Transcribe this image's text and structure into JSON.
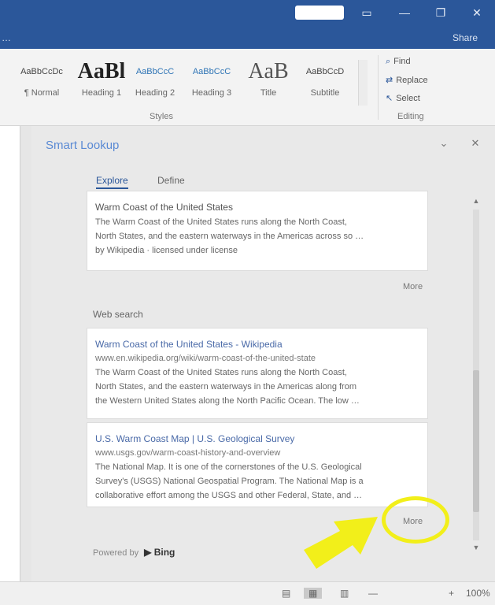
{
  "titlebar": {
    "controls": [
      "▭",
      "—",
      "❐",
      "✕"
    ]
  },
  "tellbar": {
    "left_text": "…",
    "right_text": "Share"
  },
  "ribbon": {
    "styles": [
      {
        "sample": "AaBbCcDc",
        "name": "¶ Normal"
      },
      {
        "sample": "AaBl",
        "name": "Heading 1"
      },
      {
        "sample": "AaBbCcC",
        "name": "Heading 2"
      },
      {
        "sample": "AaBbCcC",
        "name": "Heading 3"
      },
      {
        "sample": "AaB",
        "name": "Title"
      },
      {
        "sample": "AaBbCcD",
        "name": "Subtitle"
      }
    ],
    "group_styles": "Styles",
    "group_editing": "Editing",
    "editing": [
      "Find",
      "Replace",
      "Select"
    ]
  },
  "smart_lookup": {
    "title": "Smart Lookup",
    "tabs": [
      "Explore",
      "Define"
    ],
    "definition_card": {
      "title": "Warm Coast of the United States",
      "lines": [
        "The Warm Coast of the United States runs along the North Coast,",
        "North States, and the eastern waterways in the Americas across so …",
        "by Wikipedia · licensed under license"
      ]
    },
    "more_1": "More",
    "web_section": "Web search",
    "results": [
      {
        "title": "Warm Coast of the United States - Wikipedia",
        "url": "www.en.wikipedia.org/wiki/warm-coast-of-the-united-state",
        "lines": [
          "The Warm Coast of the United States runs along the North Coast,",
          "North States, and the eastern waterways in the Americas along from",
          "the Western United States along the North Pacific Ocean. The low …"
        ]
      },
      {
        "title": "U.S. Warm Coast Map | U.S. Geological Survey",
        "url": "www.usgs.gov/warm-coast-history-and-overview",
        "lines": [
          "The National Map. It is one of the cornerstones of the U.S. Geological",
          "Survey's (USGS) National Geospatial Program. The National Map is a",
          "collaborative effort among the USGS and other Federal, State, and …"
        ]
      }
    ],
    "more_2": "More",
    "powered_by": "Powered by",
    "bing": "▶ Bing"
  },
  "statusbar": {
    "icons": [
      "▤",
      "▦",
      "▥",
      "—",
      "+",
      "100%"
    ]
  },
  "colors": {
    "brand": "#2b579a",
    "highlight": "#f2ef1a"
  }
}
